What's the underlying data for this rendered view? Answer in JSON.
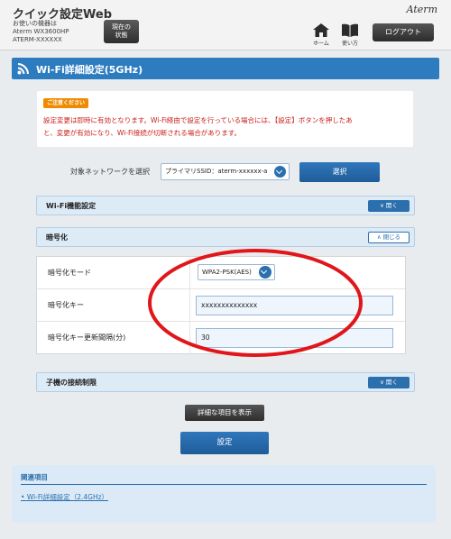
{
  "header": {
    "app_title": "クイック設定Web",
    "device_line1": "お使いの機器は",
    "device_line2": "Aterm WX3600HP",
    "device_line3": "ATERM-XXXXXX",
    "status_button_line1": "現在の",
    "status_button_line2": "状態",
    "brand": "Aterm",
    "home_label": "ホーム",
    "help_label": "使い方",
    "logout_label": "ログアウト"
  },
  "page": {
    "title": "Wi-Fi詳細設定(5GHz)",
    "title_icon": "wifi-icon"
  },
  "notice": {
    "badge": "ご注意ください",
    "line1": "設定変更は即時に有効となります。Wi-Fi経由で設定を行っている場合には、【設定】ボタンを押したあ",
    "line2": "と、変更が有効になり、Wi-Fi接続が切断される場合があります。"
  },
  "network_select": {
    "label": "対象ネットワークを選択",
    "value": "プライマリSSID：aterm-xxxxxx-a",
    "button": "選択"
  },
  "sections": {
    "wifi_function": {
      "label": "Wi-Fi機能設定",
      "toggle": "開く"
    },
    "encryption": {
      "label": "暗号化",
      "toggle": "閉じる"
    },
    "client_limit": {
      "label": "子機の接続制限",
      "toggle": "開く"
    }
  },
  "encryption_rows": {
    "mode_label": "暗号化モード",
    "mode_value": "WPA2-PSK(AES)",
    "key_label": "暗号化キー",
    "key_value": "xxxxxxxxxxxxxx",
    "interval_label": "暗号化キー更新間隔(分)",
    "interval_value": "30"
  },
  "buttons": {
    "show_details": "詳細な項目を表示",
    "apply": "設定"
  },
  "related": {
    "title": "関連項目",
    "link": "Wi-Fi詳細設定（2.4GHz）"
  },
  "colors": {
    "accent": "#2e7cc0",
    "warning": "#c8201a",
    "badge": "#f08a00",
    "annotation": "#e0161b"
  }
}
